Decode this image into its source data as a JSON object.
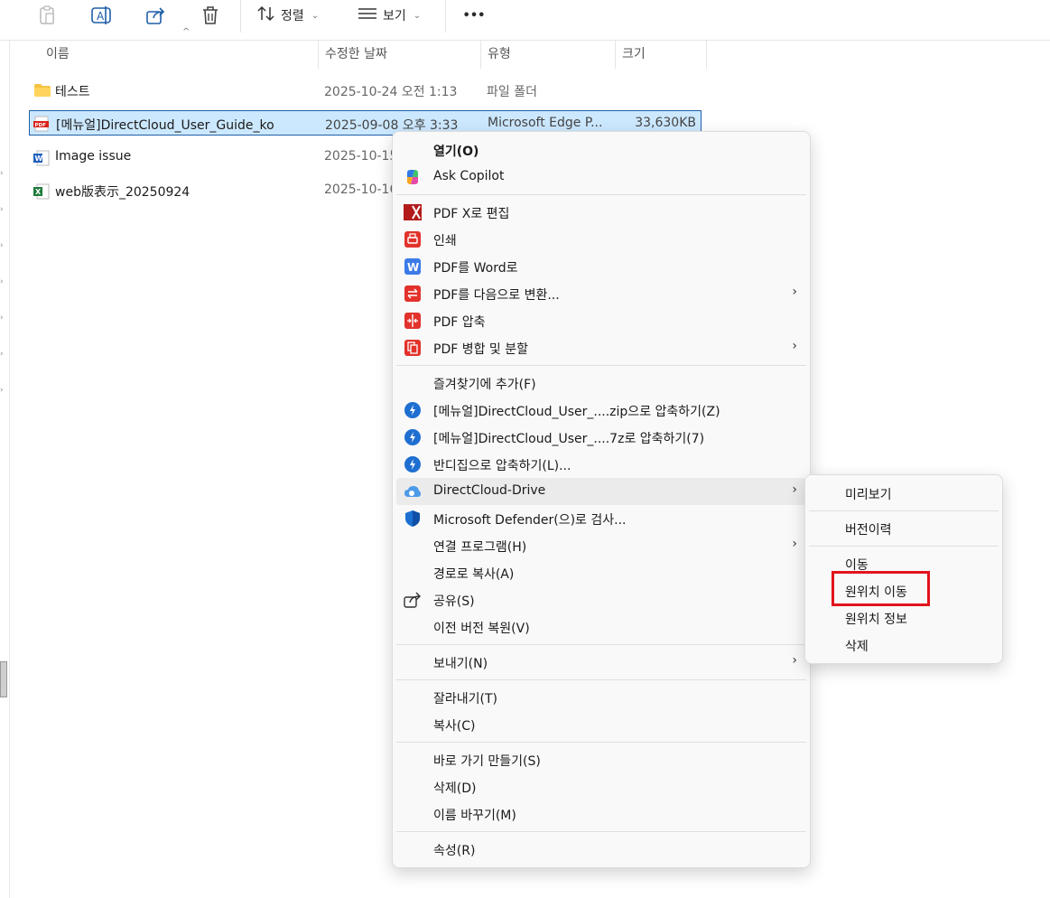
{
  "toolbar": {
    "sort_label": "정렬",
    "view_label": "보기",
    "more_label": "•••"
  },
  "columns": {
    "name": "이름",
    "modified": "수정한 날짜",
    "type": "유형",
    "size": "크기"
  },
  "files": [
    {
      "name": "테스트",
      "modified": "2025-10-24 오전 1:13",
      "type": "파일 폴더",
      "size": "",
      "icon": "folder-icon"
    },
    {
      "name": "[메뉴얼]DirectCloud_User_Guide_ko",
      "modified": "2025-09-08 오후 3:33",
      "type": "Microsoft Edge P...",
      "size": "33,630KB",
      "icon": "pdf-file-icon"
    },
    {
      "name": "Image issue",
      "modified": "2025-10-15",
      "type": "",
      "size": "",
      "icon": "word-file-icon"
    },
    {
      "name": "web版表示_20250924",
      "modified": "2025-10-16",
      "type": "",
      "size": "",
      "icon": "excel-file-icon"
    }
  ],
  "context_menu": {
    "open": "열기(O)",
    "ask_copilot": "Ask Copilot",
    "pdfx_edit": "PDF X로 편집",
    "print": "인쇄",
    "pdf_to_word": "PDF를 Word로",
    "pdf_convert": "PDF를 다음으로 변환...",
    "pdf_compress": "PDF 압축",
    "pdf_merge_split": "PDF 병합 및 분할",
    "add_favorites": "즐겨찾기에 추가(F)",
    "zip_compress": "[메뉴얼]DirectCloud_User_....zip으로 압축하기(Z)",
    "7z_compress": "[메뉴얼]DirectCloud_User_....7z로 압축하기(7)",
    "bandizip_compress": "반디집으로 압축하기(L)...",
    "directcloud_drive": "DirectCloud-Drive",
    "defender_scan": "Microsoft Defender(으)로 검사...",
    "open_with": "연결 프로그램(H)",
    "copy_path": "경로로 복사(A)",
    "share": "공유(S)",
    "restore_previous": "이전 버전 복원(V)",
    "send_to": "보내기(N)",
    "cut": "잘라내기(T)",
    "copy": "복사(C)",
    "create_shortcut": "바로 가기 만들기(S)",
    "delete": "삭제(D)",
    "rename": "이름 바꾸기(M)",
    "properties": "속성(R)"
  },
  "submenu": {
    "preview": "미리보기",
    "version_history": "버전이력",
    "move": "이동",
    "move_to_original": "원위치 이동",
    "original_location_info": "원위치 정보",
    "delete": "삭제"
  },
  "colors": {
    "selection": "#cce8ff",
    "highlight_box": "#e2141c"
  }
}
